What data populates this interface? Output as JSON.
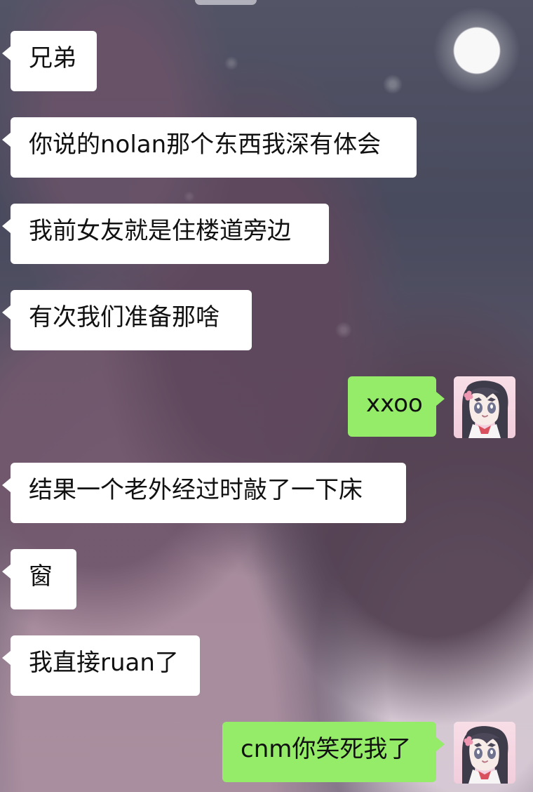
{
  "messages": [
    {
      "direction": "incoming",
      "text": "兄弟"
    },
    {
      "direction": "incoming",
      "text": "你说的nolan那个东西我深有体会"
    },
    {
      "direction": "incoming",
      "text": "我前女友就是住楼道旁边"
    },
    {
      "direction": "incoming",
      "text": "有次我们准备那啥"
    },
    {
      "direction": "outgoing",
      "text": "xxoo"
    },
    {
      "direction": "incoming",
      "text": "结果一个老外经过时敲了一下床"
    },
    {
      "direction": "incoming",
      "text": "窗"
    },
    {
      "direction": "incoming",
      "text": "我直接ruan了"
    },
    {
      "direction": "outgoing",
      "text": "cnm你笑死我了"
    }
  ],
  "colors": {
    "incoming_bubble": "#ffffff",
    "outgoing_bubble": "#95ec69",
    "text": "#111111"
  }
}
